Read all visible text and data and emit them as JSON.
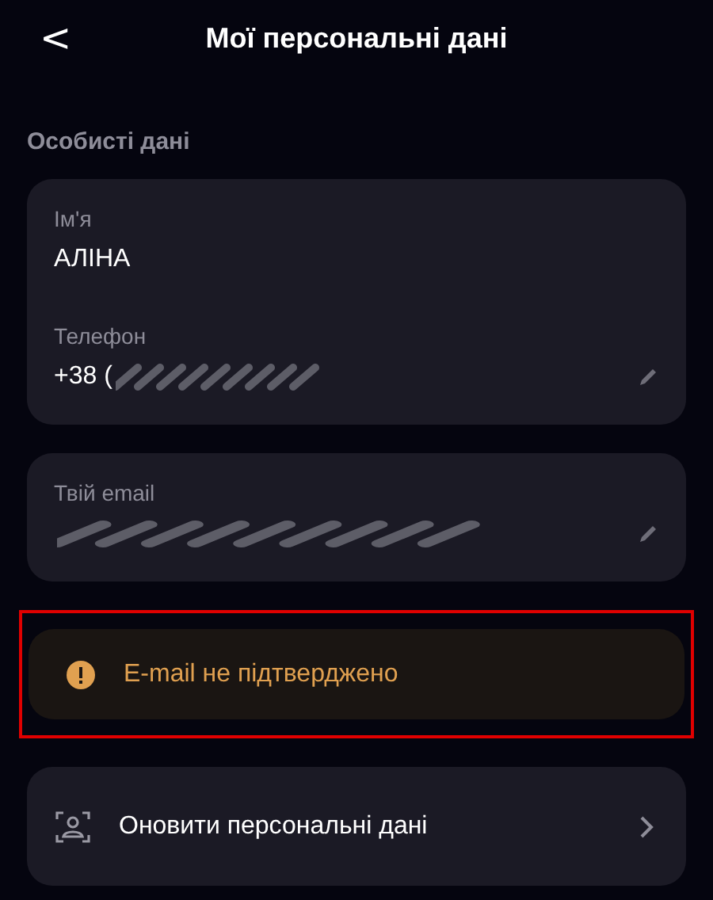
{
  "header": {
    "back": "<",
    "title": "Мої персональні дані"
  },
  "section_title": "Особисті дані",
  "cards": [
    {
      "fields": [
        {
          "label": "Ім'я",
          "value": "АЛІНА",
          "redacted": false,
          "editable": false
        },
        {
          "label": "Телефон",
          "value": "+38 (",
          "redacted": true,
          "editable": true
        }
      ]
    },
    {
      "fields": [
        {
          "label": "Твій email",
          "redacted": true,
          "editable": true
        }
      ]
    }
  ],
  "warning": {
    "text": "E-mail не підтверджено",
    "highlighted": true
  },
  "action": {
    "label": "Оновити персональні дані"
  }
}
